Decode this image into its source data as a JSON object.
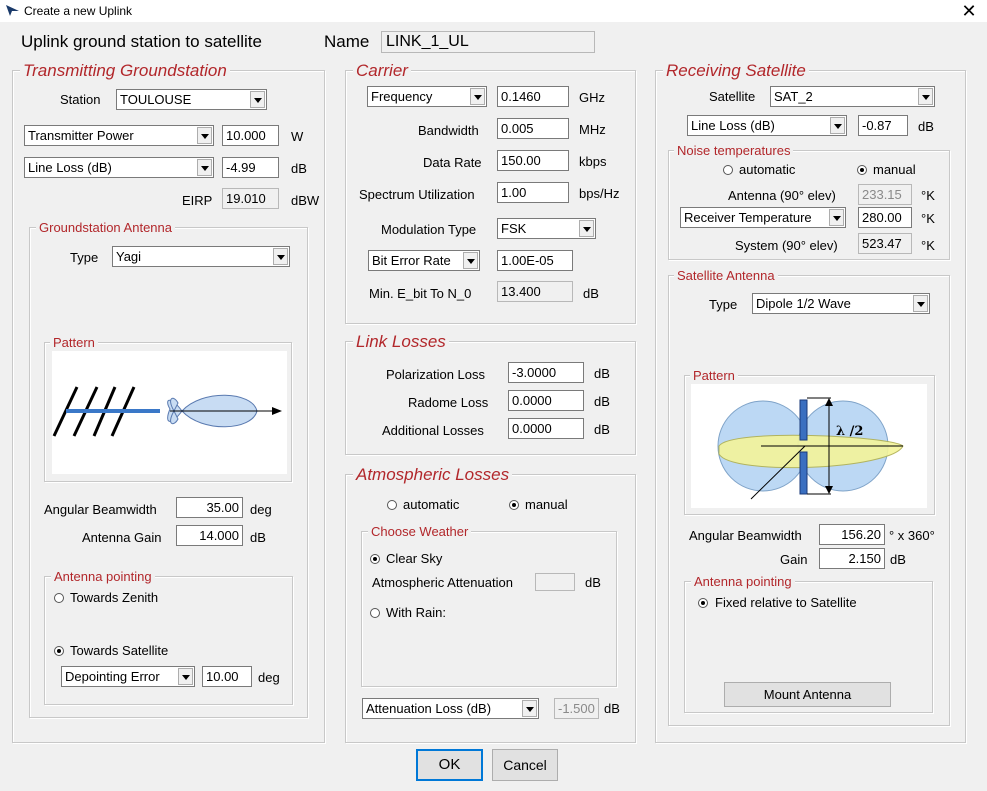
{
  "window": {
    "title": "Create a new Uplink",
    "close_glyph": "✕"
  },
  "header": {
    "title": "Uplink ground station to satellite",
    "name_label": "Name",
    "name_value": "LINK_1_UL"
  },
  "tx": {
    "legend": "Transmitting Groundstation",
    "station_label": "Station",
    "station_value": "TOULOUSE",
    "power_select": "Transmitter Power",
    "power_value": "10.000",
    "power_unit": "W",
    "lineloss_select": "Line Loss (dB)",
    "lineloss_value": "-4.99",
    "lineloss_unit": "dB",
    "eirp_label": "EIRP",
    "eirp_value": "19.010",
    "eirp_unit": "dBW",
    "antenna": {
      "legend": "Groundstation Antenna",
      "type_label": "Type",
      "type_value": "Yagi",
      "pattern_legend": "Pattern",
      "beamwidth_label": "Angular Beamwidth",
      "beamwidth_value": "35.00",
      "beamwidth_unit": "deg",
      "gain_label": "Antenna Gain",
      "gain_value": "14.000",
      "gain_unit": "dB",
      "pointing": {
        "legend": "Antenna pointing",
        "zenith": "Towards Zenith",
        "satellite": "Towards Satellite",
        "selected": "satellite",
        "error_select": "Depointing Error",
        "error_value": "10.00",
        "error_unit": "deg"
      }
    }
  },
  "carrier": {
    "legend": "Carrier",
    "freq_select": "Frequency",
    "freq_value": "0.1460",
    "freq_unit": "GHz",
    "bw_label": "Bandwidth",
    "bw_value": "0.005",
    "bw_unit": "MHz",
    "rate_label": "Data Rate",
    "rate_value": "150.00",
    "rate_unit": "kbps",
    "su_label": "Spectrum Utilization",
    "su_value": "1.00",
    "su_unit": "bps/Hz",
    "mod_label": "Modulation Type",
    "mod_value": "FSK",
    "ber_select": "Bit Error Rate",
    "ber_value": "1.00E-05",
    "ebn0_label": "Min. E_bit To N_0",
    "ebn0_value": "13.400",
    "ebn0_unit": "dB"
  },
  "link_losses": {
    "legend": "Link Losses",
    "pol_label": "Polarization Loss",
    "pol_value": "-3.0000",
    "pol_unit": "dB",
    "rad_label": "Radome Loss",
    "rad_value": "0.0000",
    "rad_unit": "dB",
    "add_label": "Additional Losses",
    "add_value": "0.0000",
    "add_unit": "dB"
  },
  "atmos": {
    "legend": "Atmospheric Losses",
    "automatic": "automatic",
    "manual": "manual",
    "mode": "manual",
    "weather": {
      "legend": "Choose Weather",
      "clear": "Clear Sky",
      "atten_label": "Atmospheric Attenuation",
      "atten_value": "",
      "atten_unit": "dB",
      "rain": "With Rain:",
      "selected": "clear"
    },
    "loss_select": "Attenuation Loss (dB)",
    "loss_value": "-1.500",
    "loss_unit": "dB"
  },
  "rx": {
    "legend": "Receiving Satellite",
    "sat_label": "Satellite",
    "sat_value": "SAT_2",
    "lineloss_select": "Line Loss (dB)",
    "lineloss_value": "-0.87",
    "lineloss_unit": "dB",
    "noise": {
      "legend": "Noise temperatures",
      "automatic": "automatic",
      "manual": "manual",
      "mode": "manual",
      "ant_label": "Antenna (90° elev)",
      "ant_value": "233.15",
      "ant_unit": "°K",
      "recv_select": "Receiver Temperature",
      "recv_value": "280.00",
      "recv_unit": "°K",
      "sys_label": "System (90° elev)",
      "sys_value": "523.47",
      "sys_unit": "°K"
    },
    "antenna": {
      "legend": "Satellite Antenna",
      "type_label": "Type",
      "type_value": "Dipole 1/2 Wave",
      "pattern_legend": "Pattern",
      "pattern_annotation": "λ /2",
      "beamwidth_label": "Angular Beamwidth",
      "beamwidth_value": "156.20",
      "beamwidth_unit": "° x 360°",
      "gain_label": "Gain",
      "gain_value": "2.150",
      "gain_unit": "dB",
      "pointing": {
        "legend": "Antenna pointing",
        "fixed": "Fixed relative to Satellite",
        "mount_button": "Mount Antenna"
      }
    }
  },
  "footer": {
    "ok": "OK",
    "cancel": "Cancel"
  }
}
